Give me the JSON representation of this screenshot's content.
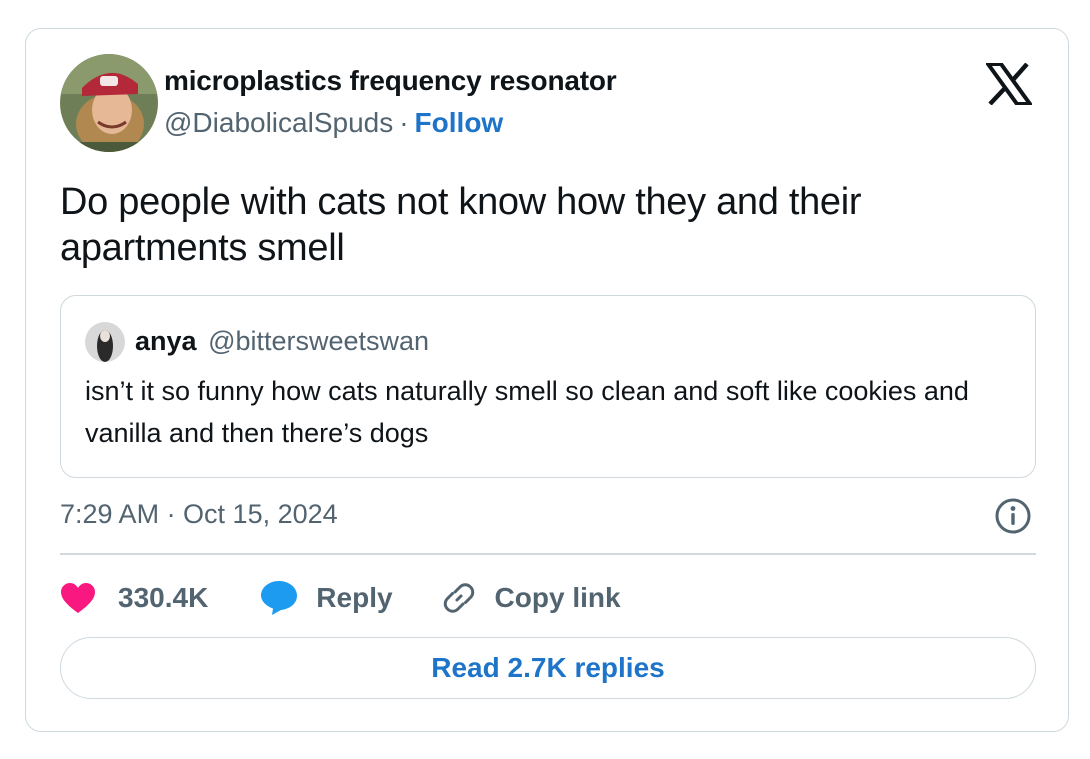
{
  "tweet": {
    "author": {
      "name": "microplastics frequency resonator",
      "handle": "@DiabolicalSpuds",
      "separator": "·",
      "follow_label": "Follow"
    },
    "brand_icon": "x-logo-icon",
    "text": "Do people with cats not know how they and their apartments smell",
    "quoted": {
      "name": "anya",
      "handle": "@bittersweetswan",
      "text": "isn’t it so funny how cats naturally smell so clean and soft like cookies and vanilla and then there’s dogs"
    },
    "timestamp": "7:29 AM · Oct 15, 2024",
    "actions": {
      "like_count": "330.4K",
      "reply_label": "Reply",
      "copy_label": "Copy link"
    },
    "read_replies_label": "Read 2.7K replies"
  },
  "colors": {
    "accent": "#1d74c9",
    "like": "#f91880",
    "reply": "#1d9bf0",
    "muted": "#536471",
    "border": "#cfd9de",
    "text": "#0f1419"
  }
}
